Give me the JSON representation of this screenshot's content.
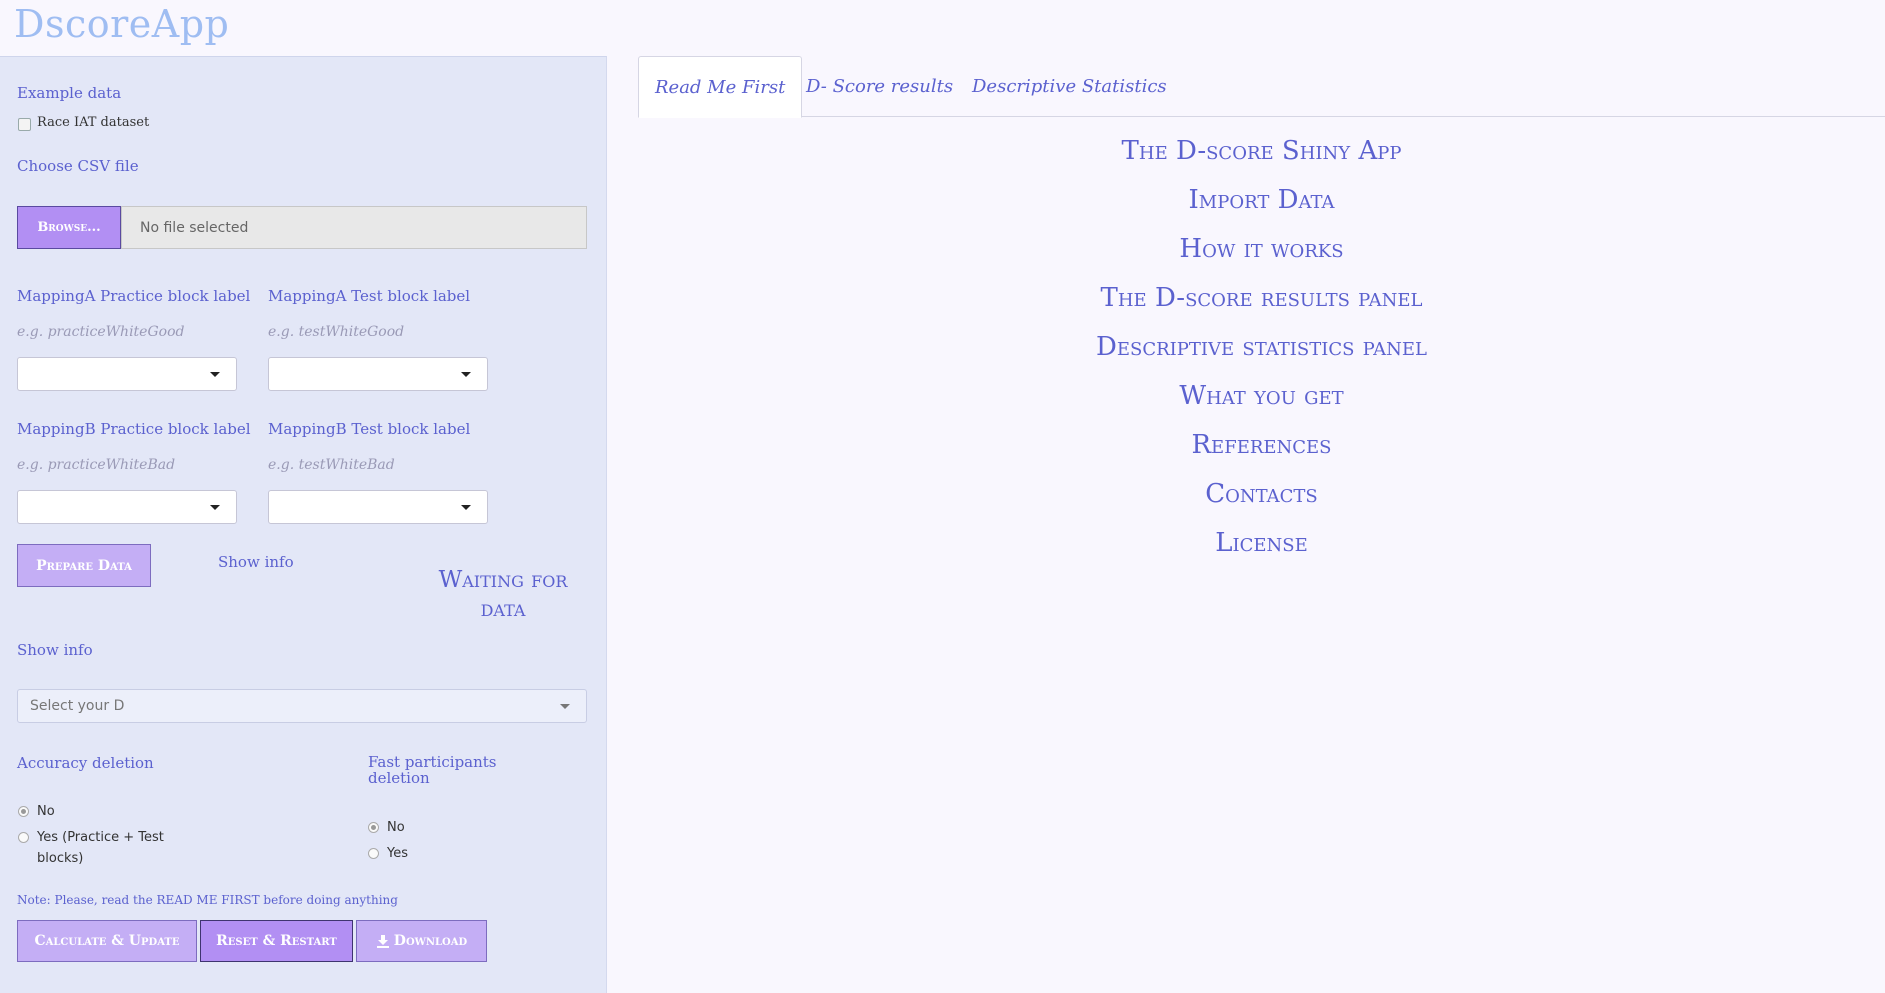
{
  "app": {
    "title": "DscoreApp"
  },
  "sidebar": {
    "example_label": "Example data",
    "race_checkbox_label": "Race IAT dataset",
    "csv_label": "Choose CSV file",
    "browse_label": "Browse...",
    "file_status": "No file selected",
    "mappingA_practice_label": "MappingA Practice block label",
    "mappingA_practice_placeholder": "e.g. practiceWhiteGood",
    "mappingA_test_label": "MappingA Test block label",
    "mappingA_test_placeholder": "e.g. testWhiteGood",
    "mappingB_practice_label": "MappingB Practice block label",
    "mappingB_practice_placeholder": "e.g. practiceWhiteBad",
    "mappingB_test_label": "MappingB Test block label",
    "mappingB_test_placeholder": "e.g. testWhiteBad",
    "prepare_label": "Prepare Data",
    "show_info_1": "Show info",
    "waiting_label": "Waiting for data",
    "show_info_2": "Show info",
    "d_select_placeholder": "Select your D",
    "accuracy_label": "Accuracy deletion",
    "accuracy_options": [
      "No",
      "Yes (Practice + Test",
      "blocks)"
    ],
    "fast_label_line1": "Fast participants",
    "fast_label_line2": "deletion",
    "fast_options": [
      "No",
      "Yes"
    ],
    "note": "Note: Please, read the READ ME FIRST before doing anything",
    "calculate_label": "Calculate & Update",
    "reset_label": "Reset & Restart",
    "download_label": "Download"
  },
  "tabs": [
    "Read Me First",
    "D- Score results",
    "Descriptive Statistics"
  ],
  "toc": [
    "The D-score Shiny App",
    "Import Data",
    "How it works",
    "The D-score results panel",
    "Descriptive statistics panel",
    "What you get",
    "References",
    "Contacts",
    "License"
  ],
  "colors": {
    "accent": "#5b61cf",
    "button": "#b28ff3",
    "sidebar": "#e3e7f7",
    "title": "#9fbdf2"
  }
}
